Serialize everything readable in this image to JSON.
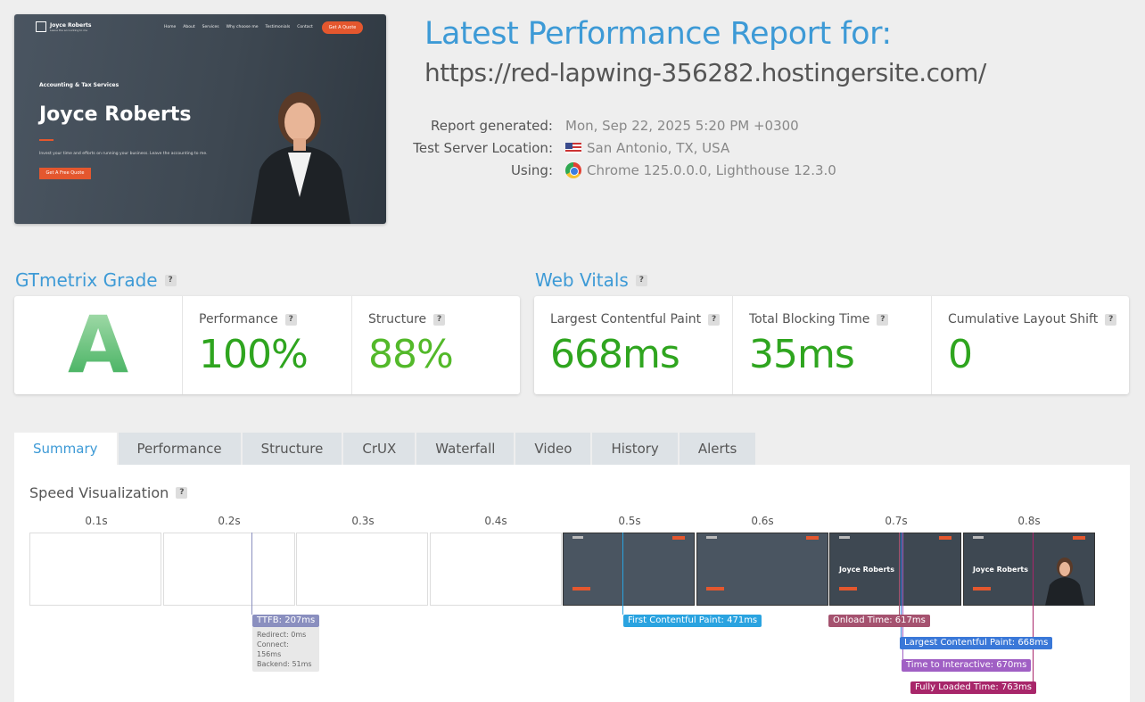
{
  "thumbnail": {
    "brand": "Joyce Roberts",
    "brand_tagline": "Leave the accounting to me",
    "nav": [
      "Home",
      "About",
      "Services",
      "Why choose me",
      "Testimonials",
      "Contact"
    ],
    "cta": "Get A Quote",
    "kicker": "Accounting & Tax Services",
    "hero": "Joyce Roberts",
    "desc": "Invest your time and efforts on running your business. Leave the accounting to me.",
    "button": "Get A Free Quote"
  },
  "header": {
    "title": "Latest Performance Report for:",
    "url": "https://red-lapwing-356282.hostingersite.com/",
    "meta": [
      {
        "key": "Report generated:",
        "value": "Mon, Sep 22, 2025 5:20 PM +0300",
        "icon": "none"
      },
      {
        "key": "Test Server Location:",
        "value": "San Antonio, TX, USA",
        "icon": "us-flag-icon"
      },
      {
        "key": "Using:",
        "value": "Chrome 125.0.0.0, Lighthouse 12.3.0",
        "icon": "chrome-icon"
      }
    ]
  },
  "grade": {
    "heading": "GTmetrix Grade",
    "letter": "A",
    "performance_label": "Performance",
    "performance_value": "100%",
    "structure_label": "Structure",
    "structure_value": "88%"
  },
  "vitals": {
    "heading": "Web Vitals",
    "lcp_label": "Largest Contentful Paint",
    "lcp_value": "668ms",
    "tbt_label": "Total Blocking Time",
    "tbt_value": "35ms",
    "cls_label": "Cumulative Layout Shift",
    "cls_value": "0"
  },
  "tabs": [
    "Summary",
    "Performance",
    "Structure",
    "CrUX",
    "Waterfall",
    "Video",
    "History",
    "Alerts"
  ],
  "speed": {
    "heading": "Speed Visualization",
    "ticks": [
      "0.1s",
      "0.2s",
      "0.3s",
      "0.4s",
      "0.5s",
      "0.6s",
      "0.7s",
      "0.8s"
    ],
    "frame_title": "Joyce Roberts",
    "ttfb": "TTFB: 207ms",
    "ttfb_details": [
      "Redirect: 0ms",
      "Connect: 156ms",
      "Backend: 51ms"
    ],
    "fcp": "First Contentful Paint: 471ms",
    "onload": "Onload Time: 617ms",
    "lcp": "Largest Contentful Paint: 668ms",
    "tti": "Time to Interactive: 670ms",
    "fully": "Fully Loaded Time: 763ms",
    "colors": {
      "ttfb": "#8a8fbf",
      "fcp": "#2aa3e0",
      "onload": "#a5526f",
      "lcp": "#3a78d8",
      "tti": "#a05fc4",
      "fully": "#a8266a"
    }
  }
}
